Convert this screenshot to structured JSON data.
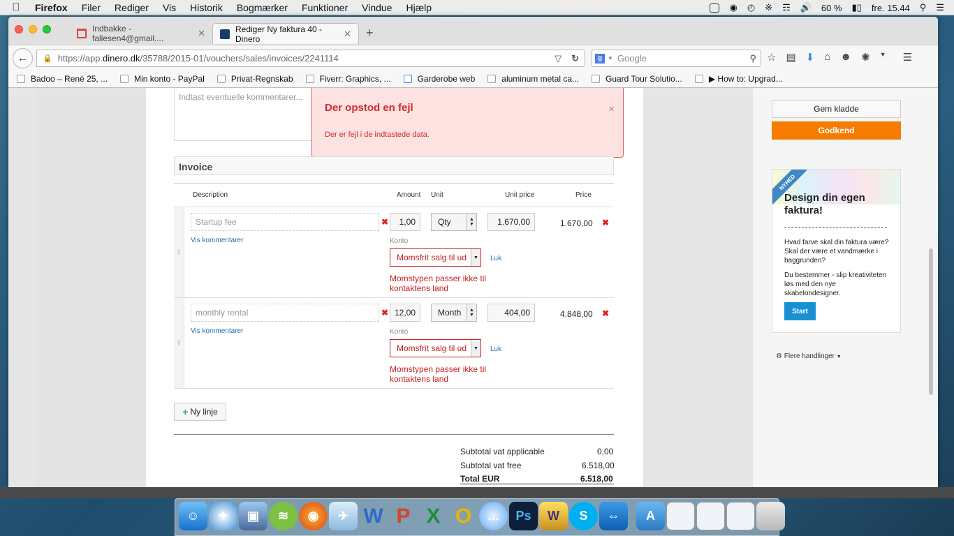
{
  "menubar": {
    "apple": "",
    "app": "Firefox",
    "items": [
      "Filer",
      "Rediger",
      "Vis",
      "Historik",
      "Bogmærker",
      "Funktioner",
      "Vindue",
      "Hjælp"
    ],
    "battery": "60 %",
    "clock": "fre. 15.44"
  },
  "tabs": [
    {
      "title": "Indbakke - fallesen4@gmail....",
      "icon": "gmail-icon"
    },
    {
      "title": "Rediger Ny faktura 40 - Dinero",
      "icon": "dinero-icon"
    }
  ],
  "nav": {
    "url_pre": "https://app.",
    "url_host": "dinero.dk",
    "url_path": "/35788/2015-01/vouchers/sales/invoices/2241114",
    "search_placeholder": "Google"
  },
  "bookmarks": [
    "Badoo – René 25, ...",
    "Min konto - PayPal",
    "Privat-Regnskab",
    "Fiverr: Graphics, ...",
    "Garderobe web",
    "aluminum metal ca...",
    "Guard Tour Solutio...",
    "▶ How to: Upgrad..."
  ],
  "page": {
    "comments_placeholder": "Indtast eventuelle kommentarer...",
    "alert": {
      "title": "Der opstod en fejl",
      "message": "Der er fejl i de indtastede data.",
      "close": "×"
    },
    "invoice_heading": "Invoice",
    "columns": {
      "description": "Description",
      "amount": "Amount",
      "unit": "Unit",
      "unit_price": "Unit price",
      "price": "Price"
    },
    "lines": [
      {
        "description_placeholder": "Startup fee",
        "amount": "1,00",
        "unit": "Qty",
        "unit_price": "1.670,00",
        "price": "1.670,00",
        "vis_kommentarer": "Vis kommentarer",
        "konto_label": "Konto",
        "konto_value": "Momsfrit salg til ud",
        "luk": "Luk",
        "error": "Momstypen passer ikke til kontaktens land"
      },
      {
        "description_placeholder": "monthly rental",
        "amount": "12,00",
        "unit": "Month",
        "unit_price": "404,00",
        "price": "4.848,00",
        "vis_kommentarer": "Vis kommentarer",
        "konto_label": "Konto",
        "konto_value": "Momsfrit salg til ud",
        "luk": "Luk",
        "error": "Momstypen passer ikke til kontaktens land"
      }
    ],
    "ny_linje": "Ny linje",
    "totals": [
      {
        "label": "Subtotal vat applicable",
        "value": "0,00"
      },
      {
        "label": "Subtotal vat free",
        "value": "6.518,00"
      },
      {
        "label": "Total EUR",
        "value": "6.518,00"
      }
    ]
  },
  "sidebar": {
    "gem_kladde": "Gem kladde",
    "godkend": "Godkend",
    "promo": {
      "ribbon": "NYHED",
      "heading": "Design din egen faktura!",
      "text1": "Hvad farve skal din faktura være? Skal der være et vandmærke i baggrunden?",
      "text2": "Du bestemmer - slip kreativiteten løs med den nye skabelondesigner.",
      "start": "Start"
    },
    "flere_handlinger": "Flere handlinger"
  },
  "colors": {
    "accent_orange": "#f57c00",
    "error_red": "#c92020",
    "link_blue": "#1f6fb5",
    "start_blue": "#1b8fd4"
  },
  "dock": [
    "finder",
    "safari",
    "preview",
    "spotify",
    "firefox",
    "mail",
    "word",
    "powerpoint",
    "excel",
    "outlook",
    "messages",
    "photoshop",
    "winrar",
    "skype",
    "teamviewer",
    "appstore",
    "screenshot1",
    "screenshot2",
    "screenshot3",
    "trash"
  ]
}
